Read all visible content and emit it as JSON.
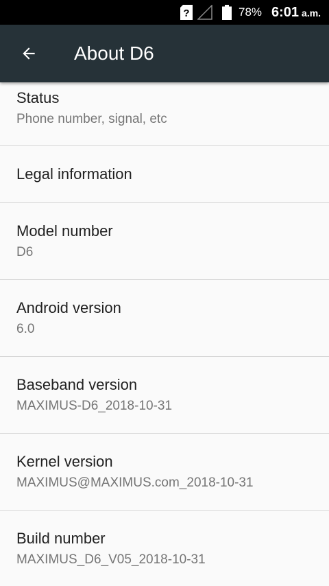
{
  "status_bar": {
    "sim_icon": "sim-unknown-icon",
    "signal_icon": "signal-empty-icon",
    "battery_icon": "battery-icon",
    "battery_percent": "78%",
    "time": "6:01",
    "ampm": "a.m."
  },
  "toolbar": {
    "back_icon": "arrow-back-icon",
    "title": "About D6"
  },
  "items": [
    {
      "title": "Status",
      "summary": "Phone number, signal, etc"
    },
    {
      "title": "Legal information",
      "summary": ""
    },
    {
      "title": "Model number",
      "summary": "D6"
    },
    {
      "title": "Android version",
      "summary": "6.0"
    },
    {
      "title": "Baseband version",
      "summary": "MAXIMUS-D6_2018-10-31"
    },
    {
      "title": "Kernel version",
      "summary": "MAXIMUS@MAXIMUS.com_2018-10-31"
    },
    {
      "title": "Build number",
      "summary": "MAXIMUS_D6_V05_2018-10-31"
    }
  ],
  "colors": {
    "toolbar": "#263238",
    "status_bar": "#000000",
    "background": "#fafafa",
    "primary_text": "#212121",
    "secondary_text": "#757575",
    "divider": "#d6d6d6"
  }
}
